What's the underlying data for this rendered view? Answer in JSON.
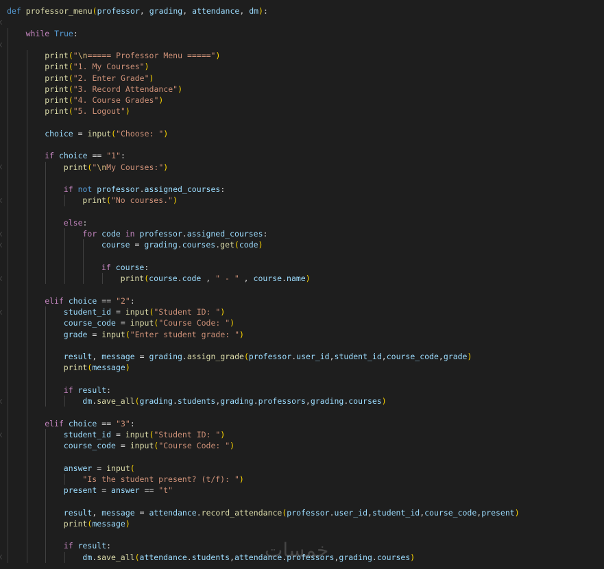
{
  "editor": {
    "language": "python",
    "background": "#1e1e1e",
    "colors": {
      "keyword": "#569cd6",
      "control": "#c586c0",
      "function": "#dcdcaa",
      "string": "#ce9178",
      "variable": "#9cdcfe",
      "escape": "#d7ba7d",
      "bracket_level1": "#ffd700",
      "bracket_level2": "#da70d6",
      "bracket_level3": "#179fff"
    },
    "lines": [
      {
        "indent": 0,
        "tokens": [
          [
            "kw",
            "def "
          ],
          [
            "fn",
            "professor_menu"
          ],
          [
            "pn1",
            "("
          ],
          [
            "var",
            "professor"
          ],
          [
            "op",
            ", "
          ],
          [
            "var",
            "grading"
          ],
          [
            "op",
            ", "
          ],
          [
            "var",
            "attendance"
          ],
          [
            "op",
            ", "
          ],
          [
            "var",
            "dm"
          ],
          [
            "pn1",
            ")"
          ],
          [
            "op",
            ":"
          ]
        ]
      },
      {
        "indent": 0,
        "tokens": []
      },
      {
        "indent": 1,
        "tokens": [
          [
            "ctl",
            "while "
          ],
          [
            "kw",
            "True"
          ],
          [
            "op",
            ":"
          ]
        ]
      },
      {
        "indent": 0,
        "tokens": []
      },
      {
        "indent": 2,
        "tokens": [
          [
            "fn",
            "print"
          ],
          [
            "pn1",
            "("
          ],
          [
            "str",
            "\""
          ],
          [
            "esc",
            "\\n"
          ],
          [
            "str",
            "===== Professor Menu =====\""
          ],
          [
            "pn1",
            ")"
          ]
        ]
      },
      {
        "indent": 2,
        "tokens": [
          [
            "fn",
            "print"
          ],
          [
            "pn1",
            "("
          ],
          [
            "str",
            "\"1. My Courses\""
          ],
          [
            "pn1",
            ")"
          ]
        ]
      },
      {
        "indent": 2,
        "tokens": [
          [
            "fn",
            "print"
          ],
          [
            "pn1",
            "("
          ],
          [
            "str",
            "\"2. Enter Grade\""
          ],
          [
            "pn1",
            ")"
          ]
        ]
      },
      {
        "indent": 2,
        "tokens": [
          [
            "fn",
            "print"
          ],
          [
            "pn1",
            "("
          ],
          [
            "str",
            "\"3. Record Attendance\""
          ],
          [
            "pn1",
            ")"
          ]
        ]
      },
      {
        "indent": 2,
        "tokens": [
          [
            "fn",
            "print"
          ],
          [
            "pn1",
            "("
          ],
          [
            "str",
            "\"4. Course Grades\""
          ],
          [
            "pn1",
            ")"
          ]
        ]
      },
      {
        "indent": 2,
        "tokens": [
          [
            "fn",
            "print"
          ],
          [
            "pn1",
            "("
          ],
          [
            "str",
            "\"5. Logout\""
          ],
          [
            "pn1",
            ")"
          ]
        ]
      },
      {
        "indent": 0,
        "tokens": []
      },
      {
        "indent": 2,
        "tokens": [
          [
            "var",
            "choice"
          ],
          [
            "op",
            " = "
          ],
          [
            "fn",
            "input"
          ],
          [
            "pn1",
            "("
          ],
          [
            "str",
            "\"Choose: \""
          ],
          [
            "pn1",
            ")"
          ]
        ]
      },
      {
        "indent": 0,
        "tokens": []
      },
      {
        "indent": 2,
        "tokens": [
          [
            "ctl",
            "if "
          ],
          [
            "var",
            "choice"
          ],
          [
            "op",
            " == "
          ],
          [
            "str",
            "\"1\""
          ],
          [
            "op",
            ":"
          ]
        ]
      },
      {
        "indent": 3,
        "tokens": [
          [
            "fn",
            "print"
          ],
          [
            "pn1",
            "("
          ],
          [
            "str",
            "\""
          ],
          [
            "esc",
            "\\n"
          ],
          [
            "str",
            "My Courses:\""
          ],
          [
            "pn1",
            ")"
          ]
        ]
      },
      {
        "indent": 0,
        "tokens": []
      },
      {
        "indent": 3,
        "tokens": [
          [
            "ctl",
            "if "
          ],
          [
            "kw",
            "not "
          ],
          [
            "var",
            "professor"
          ],
          [
            "op",
            "."
          ],
          [
            "var",
            "assigned_courses"
          ],
          [
            "op",
            ":"
          ]
        ]
      },
      {
        "indent": 4,
        "tokens": [
          [
            "fn",
            "print"
          ],
          [
            "pn1",
            "("
          ],
          [
            "str",
            "\"No courses.\""
          ],
          [
            "pn1",
            ")"
          ]
        ]
      },
      {
        "indent": 0,
        "tokens": []
      },
      {
        "indent": 3,
        "tokens": [
          [
            "ctl",
            "else"
          ],
          [
            "op",
            ":"
          ]
        ]
      },
      {
        "indent": 4,
        "tokens": [
          [
            "ctl",
            "for "
          ],
          [
            "var",
            "code"
          ],
          [
            "ctl",
            " in "
          ],
          [
            "var",
            "professor"
          ],
          [
            "op",
            "."
          ],
          [
            "var",
            "assigned_courses"
          ],
          [
            "op",
            ":"
          ]
        ]
      },
      {
        "indent": 5,
        "tokens": [
          [
            "var",
            "course"
          ],
          [
            "op",
            " = "
          ],
          [
            "var",
            "grading"
          ],
          [
            "op",
            "."
          ],
          [
            "var",
            "courses"
          ],
          [
            "op",
            "."
          ],
          [
            "fn",
            "get"
          ],
          [
            "pn1",
            "("
          ],
          [
            "var",
            "code"
          ],
          [
            "pn1",
            ")"
          ]
        ]
      },
      {
        "indent": 0,
        "tokens": []
      },
      {
        "indent": 5,
        "tokens": [
          [
            "ctl",
            "if "
          ],
          [
            "var",
            "course"
          ],
          [
            "op",
            ":"
          ]
        ]
      },
      {
        "indent": 6,
        "tokens": [
          [
            "fn",
            "print"
          ],
          [
            "pn1",
            "("
          ],
          [
            "var",
            "course"
          ],
          [
            "op",
            "."
          ],
          [
            "var",
            "code"
          ],
          [
            "op",
            " , "
          ],
          [
            "str",
            "\" - \""
          ],
          [
            "op",
            " , "
          ],
          [
            "var",
            "course"
          ],
          [
            "op",
            "."
          ],
          [
            "var",
            "name"
          ],
          [
            "pn1",
            ")"
          ]
        ]
      },
      {
        "indent": 0,
        "tokens": []
      },
      {
        "indent": 2,
        "tokens": [
          [
            "ctl",
            "elif "
          ],
          [
            "var",
            "choice"
          ],
          [
            "op",
            " == "
          ],
          [
            "str",
            "\"2\""
          ],
          [
            "op",
            ":"
          ]
        ]
      },
      {
        "indent": 3,
        "tokens": [
          [
            "var",
            "student_id"
          ],
          [
            "op",
            " = "
          ],
          [
            "fn",
            "input"
          ],
          [
            "pn1",
            "("
          ],
          [
            "str",
            "\"Student ID: \""
          ],
          [
            "pn1",
            ")"
          ]
        ]
      },
      {
        "indent": 3,
        "tokens": [
          [
            "var",
            "course_code"
          ],
          [
            "op",
            " = "
          ],
          [
            "fn",
            "input"
          ],
          [
            "pn1",
            "("
          ],
          [
            "str",
            "\"Course Code: \""
          ],
          [
            "pn1",
            ")"
          ]
        ]
      },
      {
        "indent": 3,
        "tokens": [
          [
            "var",
            "grade"
          ],
          [
            "op",
            " = "
          ],
          [
            "fn",
            "input"
          ],
          [
            "pn1",
            "("
          ],
          [
            "str",
            "\"Enter student grade: \""
          ],
          [
            "pn1",
            ")"
          ]
        ]
      },
      {
        "indent": 0,
        "tokens": []
      },
      {
        "indent": 3,
        "tokens": [
          [
            "var",
            "result"
          ],
          [
            "op",
            ", "
          ],
          [
            "var",
            "message"
          ],
          [
            "op",
            " = "
          ],
          [
            "var",
            "grading"
          ],
          [
            "op",
            "."
          ],
          [
            "fn",
            "assign_grade"
          ],
          [
            "pn1",
            "("
          ],
          [
            "var",
            "professor"
          ],
          [
            "op",
            "."
          ],
          [
            "var",
            "user_id"
          ],
          [
            "op",
            ","
          ],
          [
            "var",
            "student_id"
          ],
          [
            "op",
            ","
          ],
          [
            "var",
            "course_code"
          ],
          [
            "op",
            ","
          ],
          [
            "var",
            "grade"
          ],
          [
            "pn1",
            ")"
          ]
        ]
      },
      {
        "indent": 3,
        "tokens": [
          [
            "fn",
            "print"
          ],
          [
            "pn1",
            "("
          ],
          [
            "var",
            "message"
          ],
          [
            "pn1",
            ")"
          ]
        ]
      },
      {
        "indent": 0,
        "tokens": []
      },
      {
        "indent": 3,
        "tokens": [
          [
            "ctl",
            "if "
          ],
          [
            "var",
            "result"
          ],
          [
            "op",
            ":"
          ]
        ]
      },
      {
        "indent": 4,
        "tokens": [
          [
            "var",
            "dm"
          ],
          [
            "op",
            "."
          ],
          [
            "fn",
            "save_all"
          ],
          [
            "pn1",
            "("
          ],
          [
            "var",
            "grading"
          ],
          [
            "op",
            "."
          ],
          [
            "var",
            "students"
          ],
          [
            "op",
            ","
          ],
          [
            "var",
            "grading"
          ],
          [
            "op",
            "."
          ],
          [
            "var",
            "professors"
          ],
          [
            "op",
            ","
          ],
          [
            "var",
            "grading"
          ],
          [
            "op",
            "."
          ],
          [
            "var",
            "courses"
          ],
          [
            "pn1",
            ")"
          ]
        ]
      },
      {
        "indent": 0,
        "tokens": []
      },
      {
        "indent": 2,
        "tokens": [
          [
            "ctl",
            "elif "
          ],
          [
            "var",
            "choice"
          ],
          [
            "op",
            " == "
          ],
          [
            "str",
            "\"3\""
          ],
          [
            "op",
            ":"
          ]
        ]
      },
      {
        "indent": 3,
        "tokens": [
          [
            "var",
            "student_id"
          ],
          [
            "op",
            " = "
          ],
          [
            "fn",
            "input"
          ],
          [
            "pn1",
            "("
          ],
          [
            "str",
            "\"Student ID: \""
          ],
          [
            "pn1",
            ")"
          ]
        ]
      },
      {
        "indent": 3,
        "tokens": [
          [
            "var",
            "course_code"
          ],
          [
            "op",
            " = "
          ],
          [
            "fn",
            "input"
          ],
          [
            "pn1",
            "("
          ],
          [
            "str",
            "\"Course Code: \""
          ],
          [
            "pn1",
            ")"
          ]
        ]
      },
      {
        "indent": 0,
        "tokens": []
      },
      {
        "indent": 3,
        "tokens": [
          [
            "var",
            "answer"
          ],
          [
            "op",
            " = "
          ],
          [
            "fn",
            "input"
          ],
          [
            "pn1",
            "("
          ]
        ]
      },
      {
        "indent": 4,
        "tokens": [
          [
            "str",
            "\"Is the student present? (t/f): \""
          ],
          [
            "pn1",
            ")"
          ]
        ]
      },
      {
        "indent": 3,
        "tokens": [
          [
            "var",
            "present"
          ],
          [
            "op",
            " = "
          ],
          [
            "var",
            "answer"
          ],
          [
            "op",
            " == "
          ],
          [
            "str",
            "\"t\""
          ]
        ]
      },
      {
        "indent": 0,
        "tokens": []
      },
      {
        "indent": 3,
        "tokens": [
          [
            "var",
            "result"
          ],
          [
            "op",
            ", "
          ],
          [
            "var",
            "message"
          ],
          [
            "op",
            " = "
          ],
          [
            "var",
            "attendance"
          ],
          [
            "op",
            "."
          ],
          [
            "fn",
            "record_attendance"
          ],
          [
            "pn1",
            "("
          ],
          [
            "var",
            "professor"
          ],
          [
            "op",
            "."
          ],
          [
            "var",
            "user_id"
          ],
          [
            "op",
            ","
          ],
          [
            "var",
            "student_id"
          ],
          [
            "op",
            ","
          ],
          [
            "var",
            "course_code"
          ],
          [
            "op",
            ","
          ],
          [
            "var",
            "present"
          ],
          [
            "pn1",
            ")"
          ]
        ]
      },
      {
        "indent": 3,
        "tokens": [
          [
            "fn",
            "print"
          ],
          [
            "pn1",
            "("
          ],
          [
            "var",
            "message"
          ],
          [
            "pn1",
            ")"
          ]
        ]
      },
      {
        "indent": 0,
        "tokens": []
      },
      {
        "indent": 3,
        "tokens": [
          [
            "ctl",
            "if "
          ],
          [
            "var",
            "result"
          ],
          [
            "op",
            ":"
          ]
        ]
      },
      {
        "indent": 4,
        "tokens": [
          [
            "var",
            "dm"
          ],
          [
            "op",
            "."
          ],
          [
            "fn",
            "save_all"
          ],
          [
            "pn1",
            "("
          ],
          [
            "var",
            "attendance"
          ],
          [
            "op",
            "."
          ],
          [
            "var",
            "students"
          ],
          [
            "op",
            ","
          ],
          [
            "var",
            "attendance"
          ],
          [
            "op",
            "."
          ],
          [
            "var",
            "professors"
          ],
          [
            "op",
            ","
          ],
          [
            "var",
            "grading"
          ],
          [
            "op",
            "."
          ],
          [
            "var",
            "courses"
          ],
          [
            "pn1",
            ")"
          ]
        ]
      }
    ]
  },
  "watermark": {
    "text": "خمسات"
  }
}
